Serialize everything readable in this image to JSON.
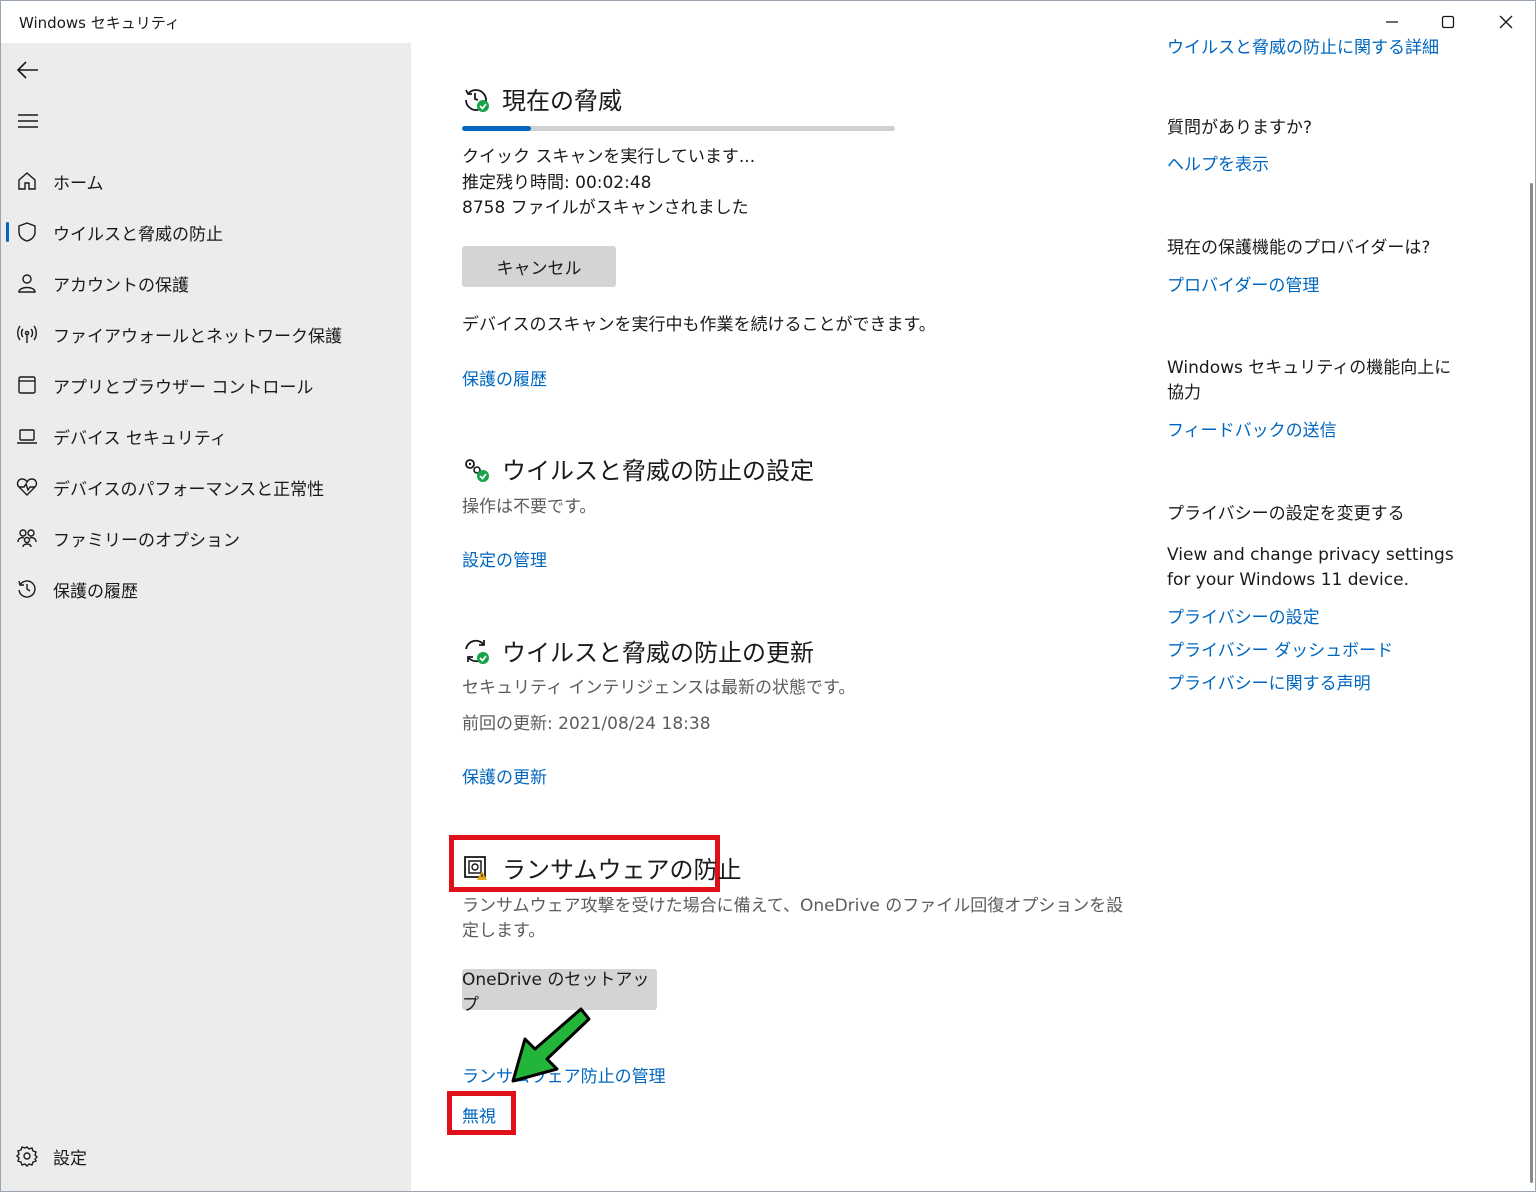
{
  "window": {
    "title": "Windows セキュリティ"
  },
  "sidebar": {
    "items": [
      {
        "label": "ホーム",
        "icon": "home-icon"
      },
      {
        "label": "ウイルスと脅威の防止",
        "icon": "shield-icon",
        "active": true
      },
      {
        "label": "アカウントの保護",
        "icon": "person-icon"
      },
      {
        "label": "ファイアウォールとネットワーク保護",
        "icon": "antenna-icon"
      },
      {
        "label": "アプリとブラウザー コントロール",
        "icon": "app-window-icon"
      },
      {
        "label": "デバイス セキュリティ",
        "icon": "laptop-icon"
      },
      {
        "label": "デバイスのパフォーマンスと正常性",
        "icon": "heart-pulse-icon"
      },
      {
        "label": "ファミリーのオプション",
        "icon": "family-icon"
      },
      {
        "label": "保護の履歴",
        "icon": "history-icon"
      }
    ],
    "settings_label": "設定"
  },
  "threats": {
    "title": "現在の脅威",
    "progress_fraction": 0.16,
    "status_line1": "クイック スキャンを実行しています...",
    "status_line2": "推定残り時間: 00:02:48",
    "status_line3": "8758 ファイルがスキャンされました",
    "cancel_label": "キャンセル",
    "note": "デバイスのスキャンを実行中も作業を続けることができます。",
    "history_link": "保護の履歴"
  },
  "settings_section": {
    "title": "ウイルスと脅威の防止の設定",
    "status": "操作は不要です。",
    "manage_link": "設定の管理"
  },
  "updates_section": {
    "title": "ウイルスと脅威の防止の更新",
    "status": "セキュリティ インテリジェンスは最新の状態です。",
    "last_update": "前回の更新: 2021/08/24 18:38",
    "update_link": "保護の更新"
  },
  "ransomware": {
    "title": "ランサムウェアの防止",
    "description_line1": "ランサムウェア攻撃を受けた場合に備えて、OneDrive のファイル回復オプションを設",
    "description_line2": "定します。",
    "setup_button": "OneDrive のセットアップ",
    "manage_link": "ランサムウェア防止の管理",
    "dismiss_link": "無視"
  },
  "right_panel": {
    "top_link": "ウイルスと脅威の防止に関する詳細",
    "question_heading": "質問がありますか?",
    "help_link": "ヘルプを表示",
    "provider_heading": "現在の保護機能のプロバイダーは?",
    "provider_link": "プロバイダーの管理",
    "improve_heading": "Windows セキュリティの機能向上に協力",
    "feedback_link": "フィードバックの送信",
    "privacy_heading": "プライバシーの設定を変更する",
    "privacy_desc": "View and change privacy settings for your Windows 11 device.",
    "privacy_settings_link": "プライバシーの設定",
    "privacy_dashboard_link": "プライバシー ダッシュボード",
    "privacy_statement_link": "プライバシーに関する声明"
  },
  "colors": {
    "accent": "#0067c0",
    "annotation_red": "#e0101a",
    "annotation_arrow": "#22b53a"
  }
}
